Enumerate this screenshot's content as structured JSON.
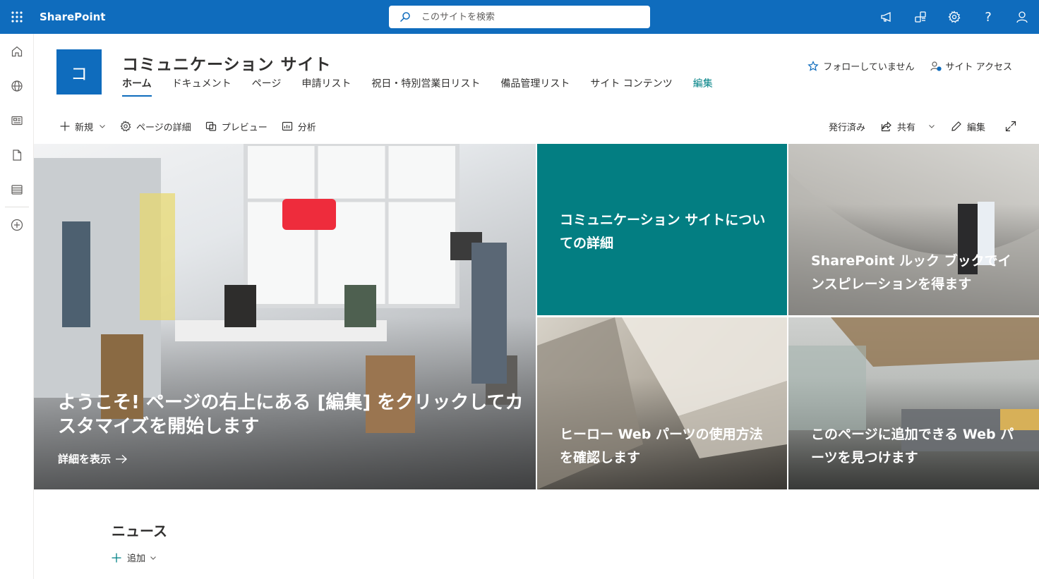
{
  "suite": {
    "app_name": "SharePoint",
    "search_placeholder": "このサイトを検索",
    "help_glyph": "?"
  },
  "site": {
    "logo_letter": "コ",
    "title": "コミュニケーション サイト",
    "nav": [
      {
        "label": "ホーム"
      },
      {
        "label": "ドキュメント"
      },
      {
        "label": "ページ"
      },
      {
        "label": "申請リスト"
      },
      {
        "label": "祝日・特別営業日リスト"
      },
      {
        "label": "備品管理リスト"
      },
      {
        "label": "サイト コンテンツ"
      },
      {
        "label": "編集"
      }
    ],
    "follow_label": "フォローしていません",
    "site_access_label": "サイト アクセス"
  },
  "commandbar": {
    "new_label": "新規",
    "page_details_label": "ページの詳細",
    "preview_label": "プレビュー",
    "analytics_label": "分析",
    "published_label": "発行済み",
    "share_label": "共有",
    "edit_label": "編集"
  },
  "hero": {
    "main_caption": "ようこそ! ページの右上にある [編集] をクリックしてカスタマイズを開始します",
    "main_link": "詳細を表示",
    "tiles": [
      {
        "caption": "コミュニケーション サイトについての詳細"
      },
      {
        "caption": "SharePoint ルック ブックでインスピレーションを得ます"
      },
      {
        "caption": "ヒーロー Web パーツの使用方法を確認します"
      },
      {
        "caption": "このページに追加できる Web パーツを見つけます"
      }
    ]
  },
  "news": {
    "title": "ニュース",
    "add_label": "追加"
  },
  "colors": {
    "suitebar": "#0f6cbd",
    "accent": "#0f6cbd",
    "teal_tile": "#037e82",
    "edit_link": "#038387"
  }
}
